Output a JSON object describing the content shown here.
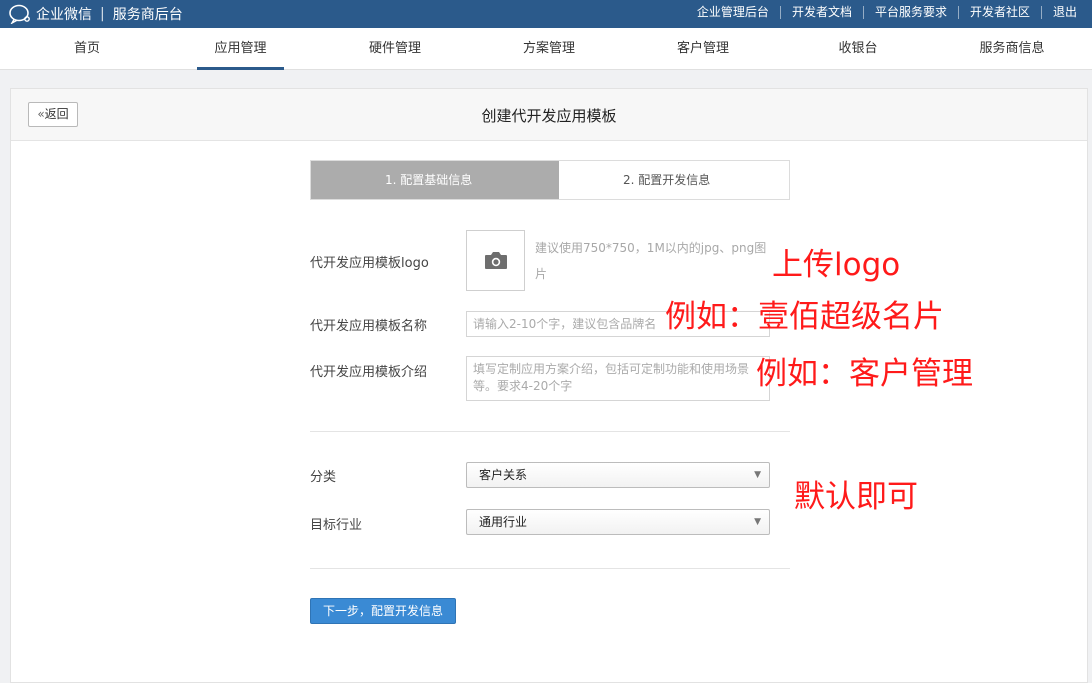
{
  "topbar": {
    "brand": "企业微信",
    "separator": "|",
    "subtitle": "服务商后台",
    "links": [
      "企业管理后台",
      "开发者文档",
      "平台服务要求",
      "开发者社区",
      "退出"
    ]
  },
  "nav": {
    "items": [
      "首页",
      "应用管理",
      "硬件管理",
      "方案管理",
      "客户管理",
      "收银台",
      "服务商信息"
    ],
    "active_index": 1
  },
  "panel": {
    "back_label": "返回",
    "title": "创建代开发应用模板"
  },
  "steps": {
    "step1": "1. 配置基础信息",
    "step2": "2. 配置开发信息",
    "active_step": 1
  },
  "form": {
    "logo_label": "代开发应用模板logo",
    "logo_hint": "建议使用750*750，1M以内的jpg、png图片",
    "name_label": "代开发应用模板名称",
    "name_placeholder": "请输入2-10个字，建议包含品牌名",
    "intro_label": "代开发应用模板介绍",
    "intro_placeholder": "填写定制应用方案介绍，包括可定制功能和使用场景等。要求4-20个字",
    "category_label": "分类",
    "category_value": "客户关系",
    "industry_label": "目标行业",
    "industry_value": "通用行业",
    "next_label": "下一步，配置开发信息"
  },
  "annotations": {
    "logo": "上传logo",
    "name": "例如：壹佰超级名片",
    "intro": "例如：客户管理",
    "defaults": "默认即可"
  },
  "colors": {
    "topbar": "#2b5a8b",
    "primary_button": "#3a8ad4",
    "step_active": "#acacac",
    "annotation": "#ff1a1a"
  },
  "icons": {
    "brand": "chat-bubble-icon",
    "back": "double-chevron-left-icon",
    "upload": "camera-icon",
    "select": "caret-down-icon"
  }
}
